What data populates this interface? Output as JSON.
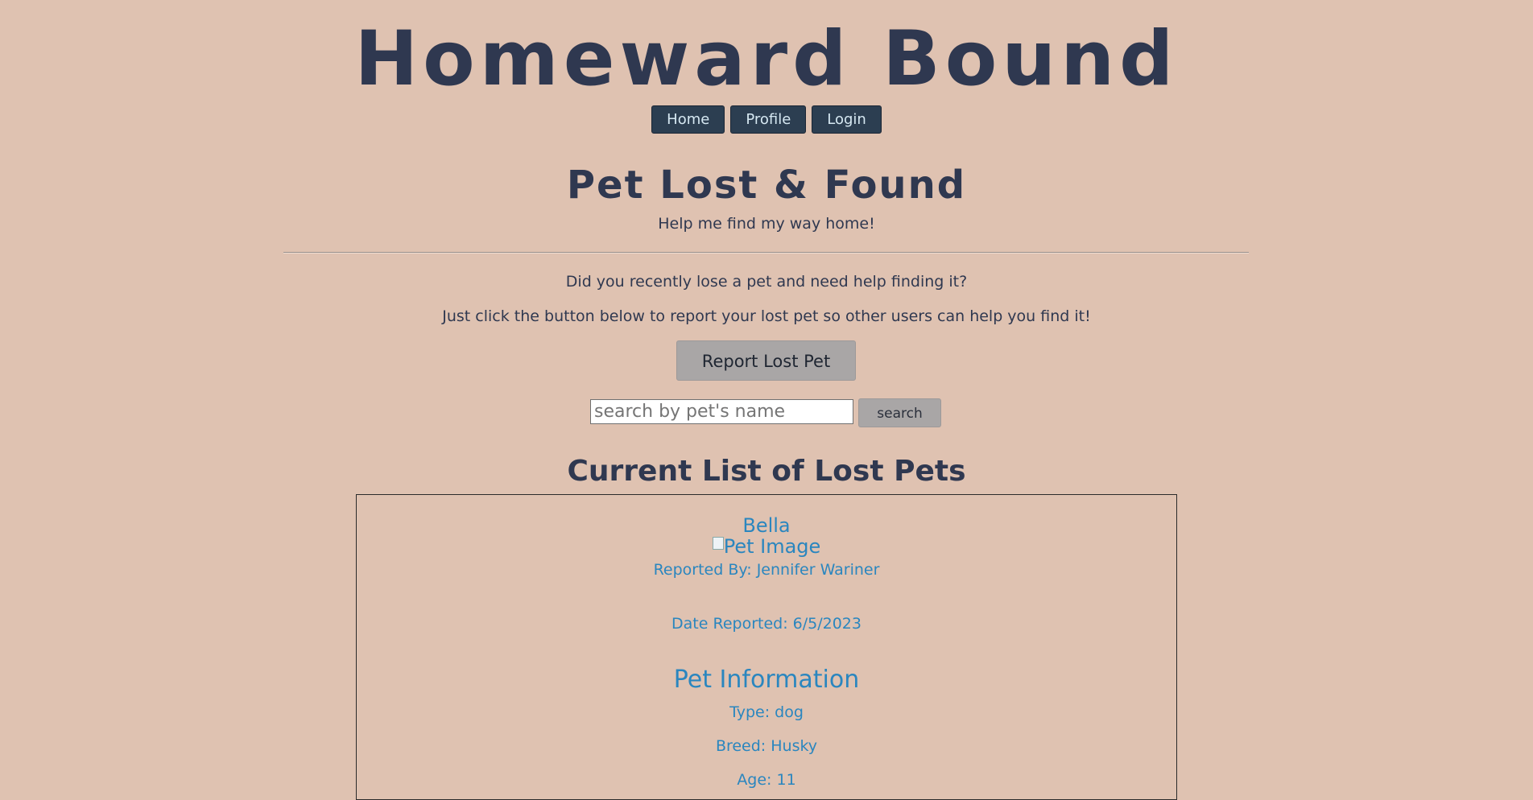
{
  "site": {
    "title": "Homeward Bound"
  },
  "nav": {
    "items": [
      "Home",
      "Profile",
      "Login"
    ]
  },
  "page": {
    "heading": "Pet Lost & Found",
    "tagline": "Help me find my way home!",
    "intro_1": "Did you recently lose a pet and need help finding it?",
    "intro_2": "Just click the button below to report your lost pet so other users can help you find it!",
    "report_button": "Report Lost Pet"
  },
  "search": {
    "placeholder": "search by pet's name",
    "button": "search"
  },
  "list": {
    "heading": "Current List of Lost Pets",
    "pets": [
      {
        "name": "Bella",
        "image_alt": "Pet Image",
        "reported_by": "Reported By: Jennifer Wariner",
        "date_reported": "Date Reported: 6/5/2023",
        "info_heading": "Pet Information",
        "type": "Type: dog",
        "breed": "Breed: Husky",
        "age": "Age: 11"
      }
    ]
  },
  "colors": {
    "background": "#dfc2b1",
    "text_dark": "#2f3850",
    "nav_button": "#2c3e51",
    "pet_text": "#2a86bf",
    "grey_button": "#a9a6a6"
  }
}
